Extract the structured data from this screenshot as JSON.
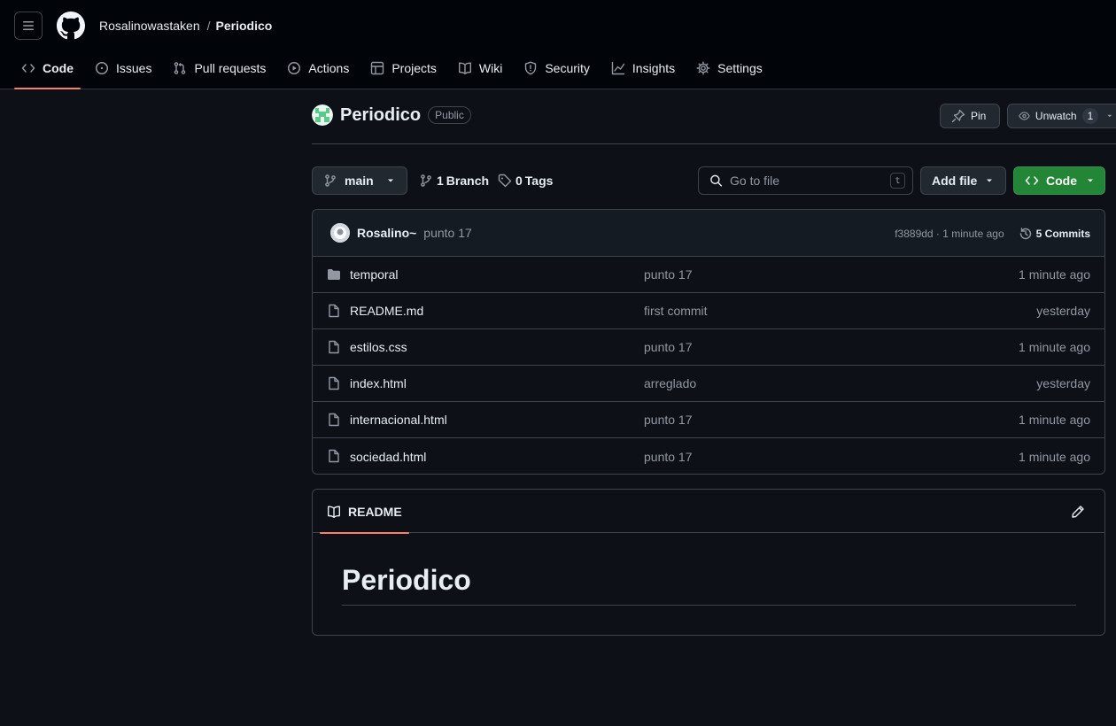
{
  "header": {
    "owner": "Rosalinowastaken",
    "separator": "/",
    "repo": "Periodico"
  },
  "nav": {
    "items": [
      {
        "label": "Code",
        "icon": "code-icon",
        "active": true
      },
      {
        "label": "Issues",
        "icon": "issue-icon"
      },
      {
        "label": "Pull requests",
        "icon": "pull-request-icon"
      },
      {
        "label": "Actions",
        "icon": "play-icon"
      },
      {
        "label": "Projects",
        "icon": "table-icon"
      },
      {
        "label": "Wiki",
        "icon": "book-icon"
      },
      {
        "label": "Security",
        "icon": "shield-icon"
      },
      {
        "label": "Insights",
        "icon": "graph-icon"
      },
      {
        "label": "Settings",
        "icon": "gear-icon"
      }
    ]
  },
  "repo": {
    "name": "Periodico",
    "visibility": "Public",
    "pin_label": "Pin",
    "watch_label": "Unwatch",
    "watch_count": "1"
  },
  "filenav": {
    "branch": "main",
    "branches_count": "1",
    "branches_label": "Branch",
    "tags_count": "0",
    "tags_label": "Tags",
    "search_placeholder": "Go to file",
    "search_shortcut": "t",
    "add_file_label": "Add file",
    "code_label": "Code"
  },
  "commit": {
    "author": "Rosalino~",
    "message": "punto 17",
    "meta": "f3889dd · 1 minute ago",
    "commits_label": "5 Commits"
  },
  "files": [
    {
      "name": "temporal",
      "type": "folder",
      "message": "punto 17",
      "date": "1 minute ago"
    },
    {
      "name": "README.md",
      "type": "file",
      "message": "first commit",
      "date": "yesterday"
    },
    {
      "name": "estilos.css",
      "type": "file",
      "message": "punto 17",
      "date": "1 minute ago"
    },
    {
      "name": "index.html",
      "type": "file",
      "message": "arreglado",
      "date": "yesterday"
    },
    {
      "name": "internacional.html",
      "type": "file",
      "message": "punto 17",
      "date": "1 minute ago"
    },
    {
      "name": "sociedad.html",
      "type": "file",
      "message": "punto 17",
      "date": "1 minute ago"
    }
  ],
  "readme": {
    "tab_label": "README",
    "heading": "Periodico"
  },
  "colors": {
    "accent_underline": "#f78166",
    "code_button": "#238636",
    "background": "#0d1117"
  }
}
